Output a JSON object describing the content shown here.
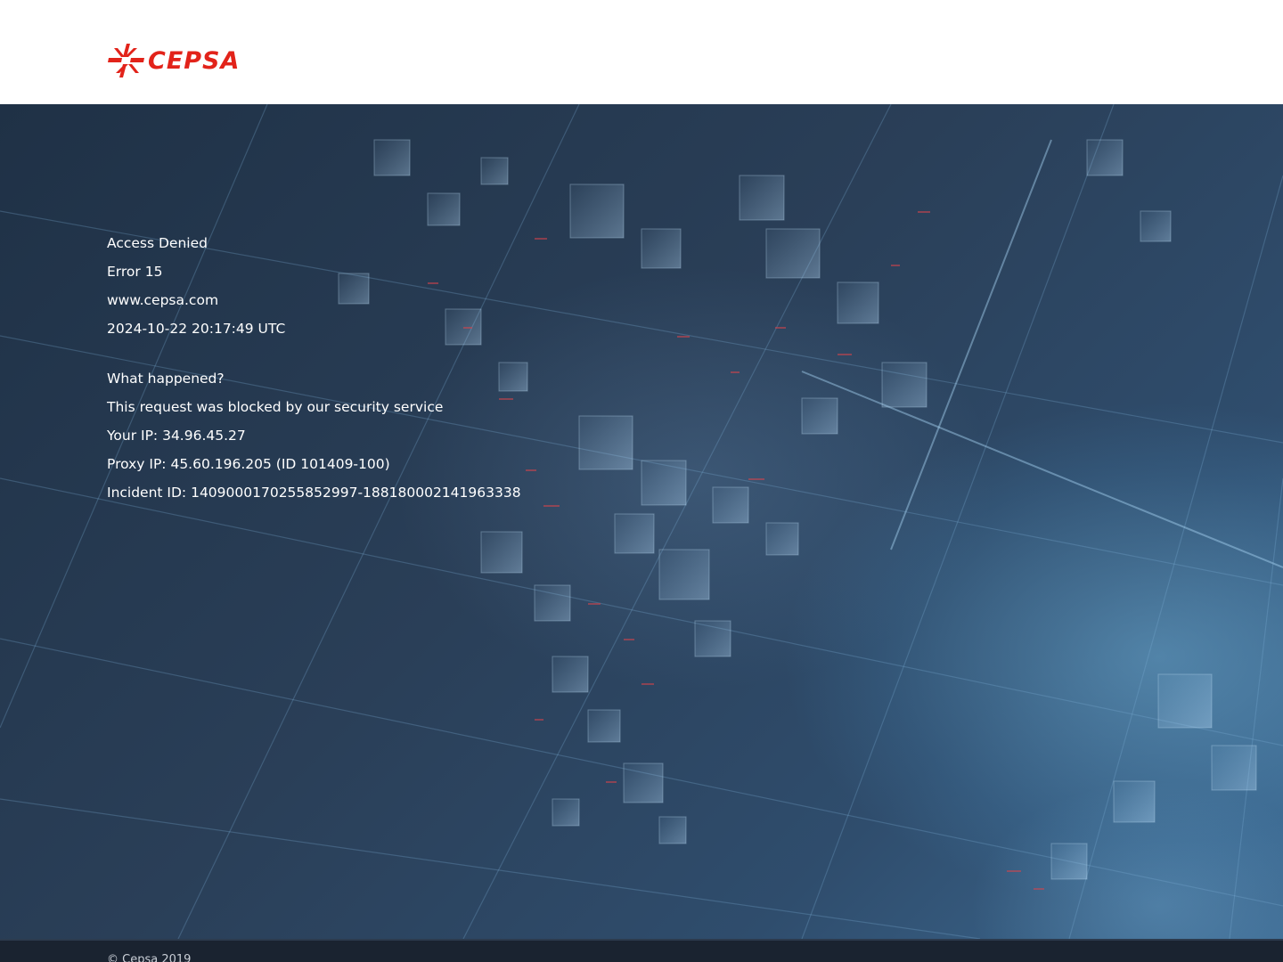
{
  "brand": {
    "name": "CEPSA",
    "color": "#e2231a"
  },
  "icons": {
    "logo": "cepsa-star-icon"
  },
  "error": {
    "title": "Access Denied",
    "code": "Error 15",
    "site": "www.cepsa.com",
    "timestamp": "2024-10-22 20:17:49 UTC",
    "question": "What happened?",
    "description": "This request was blocked by our security service",
    "your_ip": "Your IP: 34.96.45.27",
    "proxy_ip": "Proxy IP: 45.60.196.205 (ID 101409-100)",
    "incident_id": "Incident ID: 1409000170255852997-188180002141963338"
  },
  "footer": {
    "copyright": "© Cepsa 2019"
  },
  "colors": {
    "hero_base": "#26384f",
    "footer_bg": "#1a2330",
    "text": "#ffffff"
  }
}
